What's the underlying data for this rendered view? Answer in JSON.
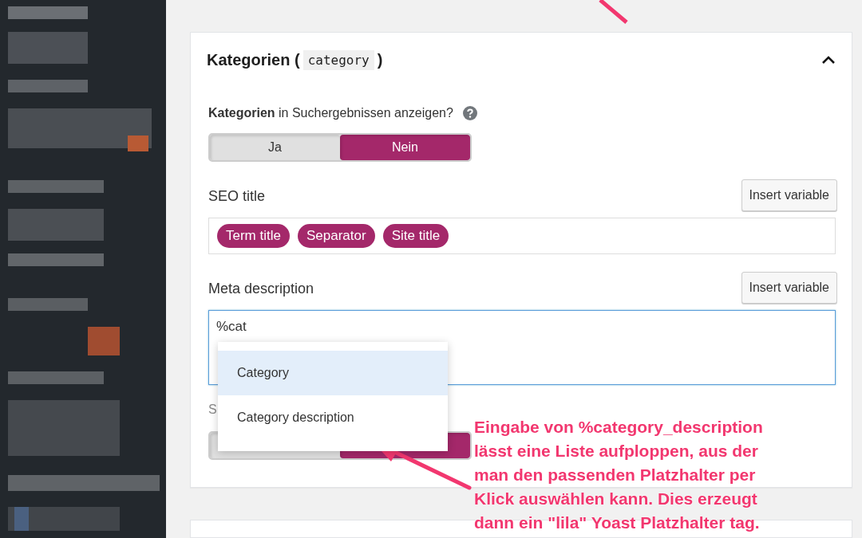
{
  "panel": {
    "title": "Kategorien (",
    "code": "category",
    "title_end": ")",
    "expanded": true
  },
  "show_in_results": {
    "label": "**Kategorien** in Suchergebnissen anzeigen?",
    "options": [
      {
        "label": "Ja",
        "selected": false
      },
      {
        "label": "Nein",
        "selected": true
      }
    ]
  },
  "seo_title": {
    "label": "SEO title",
    "button": "Insert variable",
    "tags": [
      "Term title",
      "Separator",
      "Site title"
    ]
  },
  "meta_description": {
    "label": "Meta description",
    "button": "Insert variable",
    "value": "%cat"
  },
  "suggestions": [
    {
      "label": "Category",
      "selected": true
    },
    {
      "label": "Category description",
      "selected": false
    }
  ],
  "hidden_setting": {
    "label": "S",
    "options": [
      {
        "selected": false
      },
      {
        "selected": true
      }
    ]
  },
  "annotation": {
    "text": "Eingabe von %category_description\nlässt eine Liste aufploppen, aus der\nman den passenden Platzhalter per\nKlick auswählen kann. Dies erzeugt\ndann ein \"lila\" Yoast Platzhalter tag."
  }
}
